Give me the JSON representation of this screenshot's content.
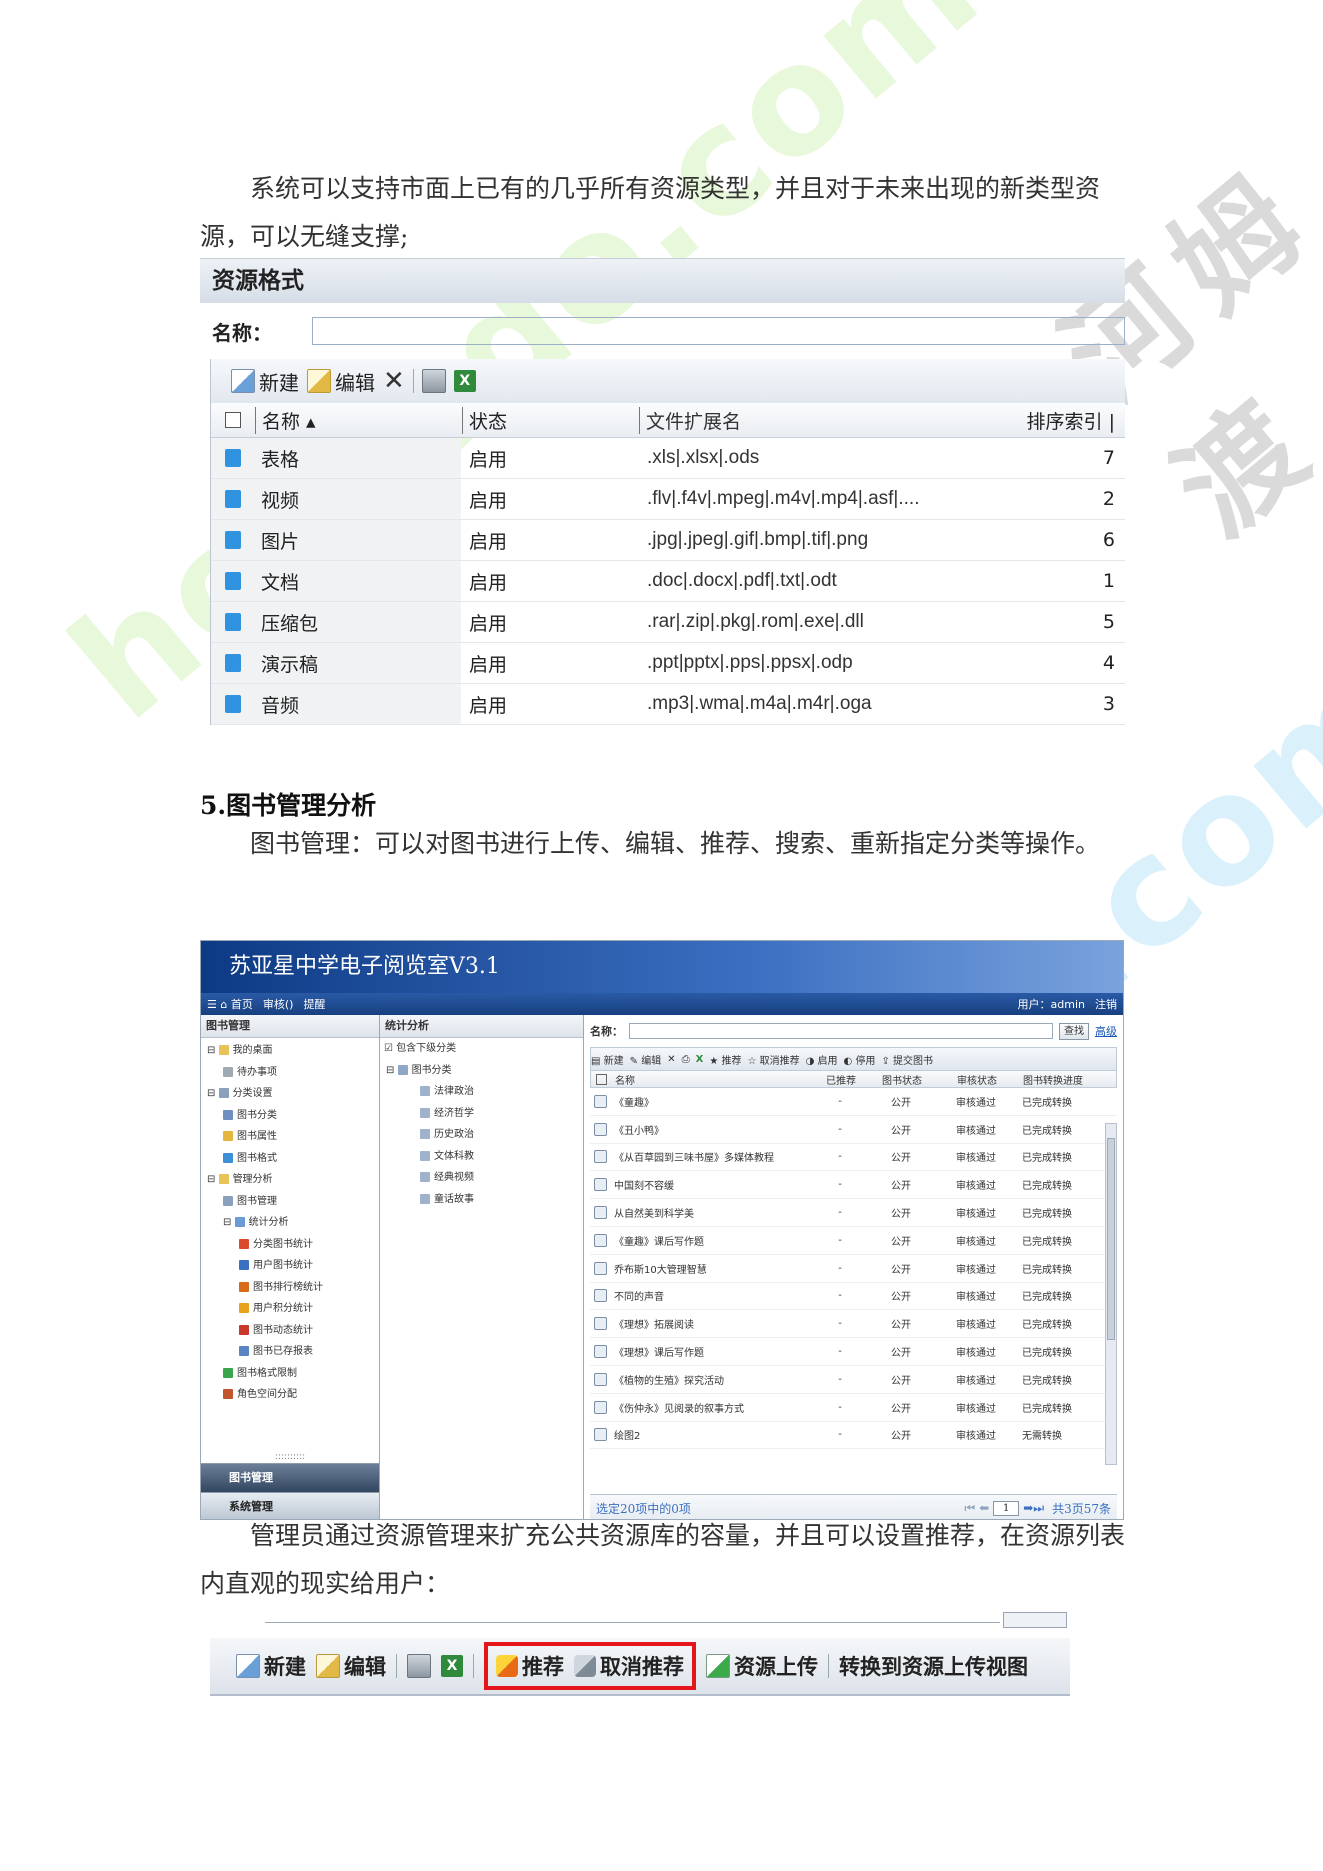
{
  "paragraph1": "系统可以支持市面上已有的几乎所有资源类型，并且对于未来出现的新类型资源，可以无缝支撑;",
  "resource_format": {
    "title": "资源格式",
    "name_label": "名称：",
    "toolbar": {
      "new": "新建",
      "edit": "编辑"
    },
    "columns": {
      "name": "名称",
      "status": "状态",
      "ext": "文件扩展名",
      "order": "排序索引"
    },
    "rows": [
      {
        "name": "表格",
        "status": "启用",
        "ext": ".xls|.xlsx|.ods",
        "order": "7"
      },
      {
        "name": "视频",
        "status": "启用",
        "ext": ".flv|.f4v|.mpeg|.m4v|.mp4|.asf|....",
        "order": "2"
      },
      {
        "name": "图片",
        "status": "启用",
        "ext": ".jpg|.jpeg|.gif|.bmp|.tif|.png",
        "order": "6"
      },
      {
        "name": "文档",
        "status": "启用",
        "ext": ".doc|.docx|.pdf|.txt|.odt",
        "order": "1"
      },
      {
        "name": "压缩包",
        "status": "启用",
        "ext": ".rar|.zip|.pkg|.rom|.exe|.dll",
        "order": "5"
      },
      {
        "name": "演示稿",
        "status": "启用",
        "ext": ".ppt|pptx|.pps|.ppsx|.odp",
        "order": "4"
      },
      {
        "name": "音频",
        "status": "启用",
        "ext": ".mp3|.wma|.m4a|.m4r|.oga",
        "order": "3"
      }
    ]
  },
  "heading": "5.图书管理分析",
  "paragraph2": "图书管理：可以对图书进行上传、编辑、推荐、搜索、重新指定分类等操作。",
  "library": {
    "banner": "苏亚星中学电子阅览室V3.1",
    "nav": {
      "home": "首页",
      "audit": "审核()",
      "remind": "提醒",
      "user": "用户：admin",
      "logout": "注销"
    },
    "left_title": "图书管理",
    "tree": [
      "我的桌面",
      "待办事项",
      "分类设置",
      "图书分类",
      "图书属性",
      "图书格式",
      "管理分析",
      "图书管理",
      "统计分析",
      "分类图书统计",
      "用户图书统计",
      "图书排行榜统计",
      "用户积分统计",
      "图书动态统计",
      "图书已存报表",
      "图书格式限制",
      "角色空间分配"
    ],
    "left_bottom": {
      "dots": "::::::::::",
      "book_mgmt": "图书管理",
      "sys_mgmt": "系统管理"
    },
    "mid_title": "统计分析",
    "mid_check": "包含下级分类",
    "mid_root": "图书分类",
    "mid_items": [
      "法律政治",
      "经济哲学",
      "历史政治",
      "文体科教",
      "经典视频",
      "童话故事"
    ],
    "search_label": "名称：",
    "search_btn": "查找",
    "advanced": "高级",
    "toolbar": {
      "new": "新建",
      "edit": "编辑",
      "recommend": "推荐",
      "unrecommend": "取消推荐",
      "enable": "启用",
      "disable": "停用",
      "submit": "提交图书"
    },
    "columns": {
      "name": "名称",
      "recommended": "已推荐",
      "book_status": "图书状态",
      "audit_status": "审核状态",
      "progress": "图书转换进度"
    },
    "rows": [
      {
        "name": "《童趣》",
        "rec": "-",
        "status": "公开",
        "audit": "审核通过",
        "progress": "已完成转换"
      },
      {
        "name": "《丑小鸭》",
        "rec": "-",
        "status": "公开",
        "audit": "审核通过",
        "progress": "已完成转换"
      },
      {
        "name": "《从百草园到三味书屋》多媒体教程",
        "rec": "-",
        "status": "公开",
        "audit": "审核通过",
        "progress": "已完成转换"
      },
      {
        "name": "中国刻不容缓",
        "rec": "-",
        "status": "公开",
        "audit": "审核通过",
        "progress": "已完成转换"
      },
      {
        "name": "从自然美到科学美",
        "rec": "-",
        "status": "公开",
        "audit": "审核通过",
        "progress": "已完成转换"
      },
      {
        "name": "《童趣》课后写作题",
        "rec": "-",
        "status": "公开",
        "audit": "审核通过",
        "progress": "已完成转换"
      },
      {
        "name": "乔布斯10大管理智慧",
        "rec": "-",
        "status": "公开",
        "audit": "审核通过",
        "progress": "已完成转换"
      },
      {
        "name": "不同的声音",
        "rec": "-",
        "status": "公开",
        "audit": "审核通过",
        "progress": "已完成转换"
      },
      {
        "name": "《理想》拓展阅读",
        "rec": "-",
        "status": "公开",
        "audit": "审核通过",
        "progress": "已完成转换"
      },
      {
        "name": "《理想》课后写作题",
        "rec": "-",
        "status": "公开",
        "audit": "审核通过",
        "progress": "已完成转换"
      },
      {
        "name": "《植物的生殖》探究活动",
        "rec": "-",
        "status": "公开",
        "audit": "审核通过",
        "progress": "已完成转换"
      },
      {
        "name": "《伤仲永》见阅录的叙事方式",
        "rec": "-",
        "status": "公开",
        "audit": "审核通过",
        "progress": "已完成转换"
      },
      {
        "name": "绘图2",
        "rec": "-",
        "status": "公开",
        "audit": "审核通过",
        "progress": "无需转换"
      }
    ],
    "footer_left": "选定20项中的0项",
    "page_num": "1",
    "footer_right": "共3页57条"
  },
  "paragraph3": "管理员通过资源管理来扩充公共资源库的容量，并且可以设置推荐，在资源列表内直观的现实给用户：",
  "bottom_toolbar": {
    "new": "新建",
    "edit": "编辑",
    "recommend": "推荐",
    "unrecommend": "取消推荐",
    "upload": "资源上传",
    "switch": "转换到资源上传视图"
  },
  "watermark": {
    "a": "homedo.com",
    "b": "homedo.com",
    "c": "河姆渡"
  }
}
